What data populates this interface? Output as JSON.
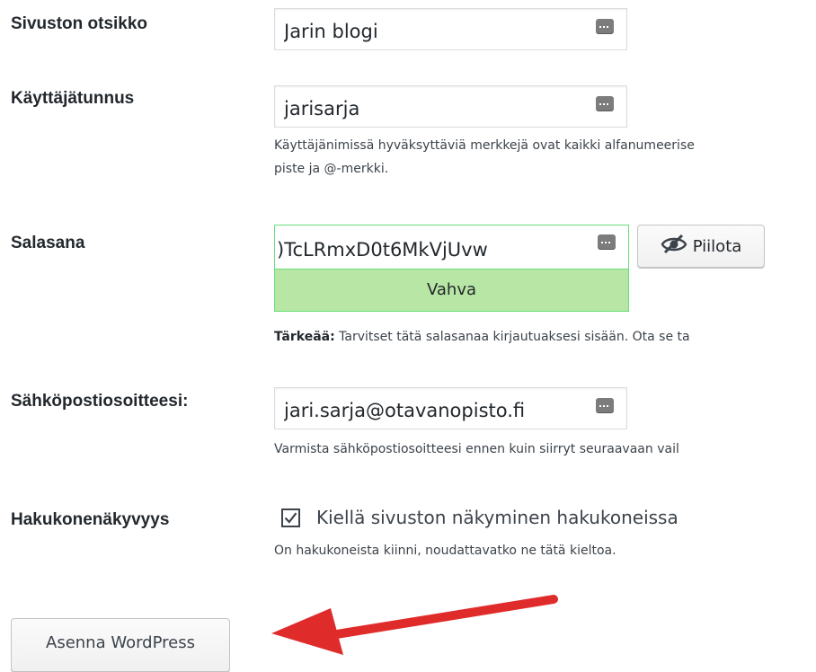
{
  "form": {
    "site_title": {
      "label": "Sivuston otsikko",
      "value": "Jarin blogi"
    },
    "username": {
      "label": "Käyttäjätunnus",
      "value": "jarisarja",
      "help_line1": "Käyttäjänimissä hyväksyttäviä merkkejä ovat kaikki alfanumeerise",
      "help_line2": "piste ja @-merkki."
    },
    "password": {
      "label": "Salasana",
      "value": ")TcLRmxD0t6MkVjUvw",
      "strength": "Vahva",
      "hide_button": "Piilota",
      "note_strong": "Tärkeää:",
      "note_rest": " Tarvitset tätä salasanaa kirjautuaksesi sisään. Ota se ta"
    },
    "email": {
      "label": "Sähköpostiosoitteesi:",
      "value": "jari.sarja@otavanopisto.fi",
      "help": "Varmista sähköpostiosoitteesi ennen kuin siirryt seuraavaan vail"
    },
    "search_visibility": {
      "label": "Hakukonenäkyvyys",
      "checkbox_label": "Kiellä sivuston näkyminen hakukoneissa",
      "checked": true,
      "help": "On hakukoneista kiinni, noudattavatko ne tätä kieltoa."
    },
    "submit_label": "Asenna WordPress"
  },
  "colors": {
    "strength_bg": "#b8e6a5",
    "strength_border": "#68de7c",
    "arrow": "#e02b2b"
  },
  "icons": {
    "password_manager": "password-manager-icon",
    "hide": "eye-slash-icon",
    "checkbox": "checkmark-icon",
    "annotation": "red-arrow-annotation"
  }
}
